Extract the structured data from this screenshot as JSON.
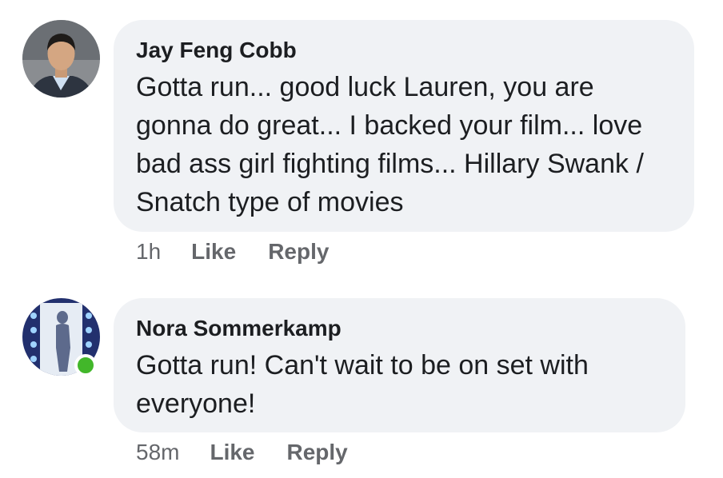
{
  "comments": [
    {
      "author": "Jay Feng Cobb",
      "text": "Gotta run... good luck Lauren, you are gonna do great... I backed your film... love bad ass girl fighting films... Hillary Swank / Snatch type of movies",
      "time": "1h",
      "like_label": "Like",
      "reply_label": "Reply",
      "online": false
    },
    {
      "author": "Nora Sommerkamp",
      "text": "Gotta run! Can't wait to be on set with everyone!",
      "time": "58m",
      "like_label": "Like",
      "reply_label": "Reply",
      "online": true
    }
  ],
  "colors": {
    "bubble": "#f0f2f5",
    "meta_text": "#65676b",
    "online": "#42b72a"
  }
}
